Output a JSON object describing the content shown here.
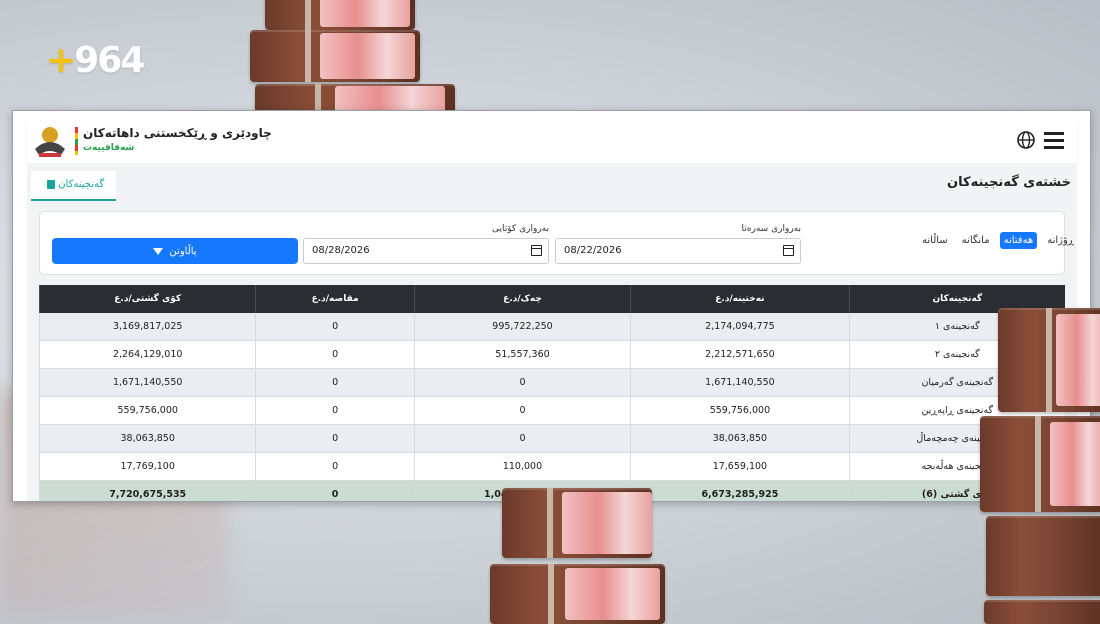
{
  "brand": {
    "plus": "+",
    "number": "964"
  },
  "header": {
    "title": "چاودێری و ڕێکخستنی داهاتەکان",
    "subtitle": "شەفافییەت"
  },
  "tabs": [
    {
      "label": "گەنجینەکان"
    }
  ],
  "page_title": "خشتەی گەنجینەکان",
  "period": {
    "options": [
      "ڕۆژانە",
      "هەفتانە",
      "مانگانە",
      "ساڵانە"
    ],
    "selected": "هەفتانە"
  },
  "filters": {
    "start_label": "بەرواری سەرەتا",
    "start_value": "08/22/2026",
    "end_label": "بەرواری کۆتایی",
    "end_value": "08/28/2026",
    "button_label": "پاڵاوتن"
  },
  "table": {
    "columns": [
      "گەنجینەکان",
      "نەختینە/د.ع",
      "چەک/د.ع",
      "مقاصە/د.ع",
      "کۆی گشتی/د.ع"
    ],
    "rows": [
      [
        "گەنجینەی ١",
        "2,174,094,775",
        "995,722,250",
        "0",
        "3,169,817,025"
      ],
      [
        "گەنجینەی ٢",
        "2,212,571,650",
        "51,557,360",
        "0",
        "2,264,129,010"
      ],
      [
        "گەنجینەی گەرمیان",
        "1,671,140,550",
        "0",
        "0",
        "1,671,140,550"
      ],
      [
        "گەنجینەی ڕاپەڕین",
        "559,756,000",
        "0",
        "0",
        "559,756,000"
      ],
      [
        "گەنجینەی چەمچەماڵ",
        "38,063,850",
        "0",
        "0",
        "38,063,850"
      ],
      [
        "گەنجینەی هەڵەبجە",
        "17,659,100",
        "110,000",
        "0",
        "17,769,100"
      ]
    ],
    "total": [
      "کۆی گشتی (6)",
      "6,673,285,925",
      "1,047,389,610",
      "0",
      "7,720,675,535"
    ]
  },
  "colors": {
    "accent": "#1677ff",
    "tab_accent": "#1aa39a",
    "header_dark": "#2a2d31",
    "total_row": "#cbdcd3"
  }
}
